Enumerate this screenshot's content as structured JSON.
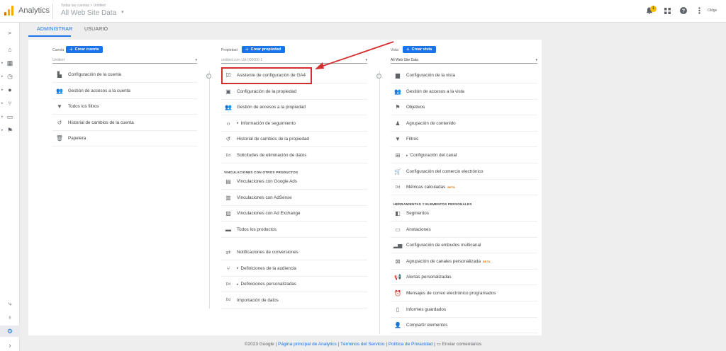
{
  "topbar": {
    "app_title": "Analytics",
    "account_line": "Todas las cuentas > Untitled",
    "view_name": "All Web Site Data",
    "notification_count": "1",
    "user_name": "Oldge",
    "icons": [
      "analytics-logo-icon",
      "bell-icon",
      "apps-icon",
      "help-icon",
      "more-vert-icon"
    ]
  },
  "leftnav": {
    "icons": [
      "search-icon",
      "home-icon",
      "dashboard-icon",
      "clock-icon",
      "person-icon",
      "branch-icon",
      "display-icon",
      "flag-icon",
      "link-icon",
      "lightbulb-icon",
      "gear-icon",
      "chevron-right-icon"
    ]
  },
  "tabs": [
    {
      "label": "ADMINISTRAR",
      "active": true
    },
    {
      "label": "USUARIO",
      "active": false
    }
  ],
  "columns": {
    "cuenta": {
      "label": "Cuenta",
      "create_label": "Crear cuenta",
      "selector": "Untitled",
      "items": [
        {
          "icon": "building-icon",
          "label": "Configuración de la cuenta"
        },
        {
          "icon": "people-icon",
          "label": "Gestión de accesos a la cuenta"
        },
        {
          "icon": "filter-icon",
          "label": "Todos los filtros"
        },
        {
          "icon": "history-icon",
          "label": "Historial de cambios de la cuenta"
        },
        {
          "icon": "trash-icon",
          "label": "Papelera"
        }
      ]
    },
    "propiedad": {
      "label": "Propiedad",
      "create_label": "Crear propiedad",
      "selector": "untitled.com UA-000000-1",
      "items": [
        {
          "icon": "checkbox-icon",
          "label": "Asistente de configuración de GA4"
        },
        {
          "icon": "window-icon",
          "label": "Configuración de la propiedad"
        },
        {
          "icon": "people-icon",
          "label": "Gestión de accesos a la propiedad"
        },
        {
          "icon": "code-icon",
          "label": "Información de seguimiento"
        },
        {
          "icon": "history-icon",
          "label": "Historial de cambios de la propiedad"
        },
        {
          "icon": "dd-icon",
          "label": "Solicitudes de eliminación de datos"
        }
      ],
      "section_title": "VINCULACIONES CON OTROS PRODUCTOS",
      "linked_items": [
        {
          "icon": "ads-icon",
          "label": "Vinculaciones con Google Ads"
        },
        {
          "icon": "adsense-icon",
          "label": "Vinculaciones con AdSense"
        },
        {
          "icon": "adexchange-icon",
          "label": "Vinculaciones con Ad Exchange"
        },
        {
          "icon": "products-icon",
          "label": "Todos los productos"
        }
      ],
      "other_items": [
        {
          "icon": "conversion-icon",
          "label": "Notificaciones de conversiones"
        },
        {
          "icon": "audience-icon",
          "label": "Definiciones de la audiencia"
        },
        {
          "icon": "dd-icon",
          "label": "Definiciones personalizadas"
        },
        {
          "icon": "dd-icon",
          "label": "Importación de datos"
        }
      ]
    },
    "vista": {
      "label": "Vista",
      "create_label": "Crear vista",
      "selector": "All Web Site Data",
      "items": [
        {
          "icon": "document-icon",
          "label": "Configuración de la vista"
        },
        {
          "icon": "people-icon",
          "label": "Gestión de accesos a la vista"
        },
        {
          "icon": "flag-icon",
          "label": "Objetivos"
        },
        {
          "icon": "person-walk-icon",
          "label": "Agrupación de contenido"
        },
        {
          "icon": "filter-icon",
          "label": "Filtros"
        },
        {
          "icon": "channel-icon",
          "label": "Configuración del canal"
        },
        {
          "icon": "cart-icon",
          "label": "Configuración del comercio electrónico"
        },
        {
          "icon": "dd-icon",
          "label": "Métricas calculadas",
          "beta": "BETA"
        }
      ],
      "section_title": "HERRAMIENTAS Y ELEMENTOS PERSONALES",
      "tool_items": [
        {
          "icon": "segments-icon",
          "label": "Segmentos"
        },
        {
          "icon": "annotation-icon",
          "label": "Anotaciones"
        },
        {
          "icon": "bar-chart-icon",
          "label": "Configuración de embudos multicanal"
        },
        {
          "icon": "channel-group-icon",
          "label": "Agrupación de canales personalizada",
          "beta": "BETA"
        },
        {
          "icon": "megaphone-icon",
          "label": "Alertas personalizadas"
        },
        {
          "icon": "alarm-icon",
          "label": "Mensajes de correo electrónico programados"
        },
        {
          "icon": "saved-report-icon",
          "label": "Informes guardados"
        },
        {
          "icon": "share-person-icon",
          "label": "Compartir elementos"
        }
      ]
    }
  },
  "footer": {
    "copyright": "©2023 Google |",
    "link1": "Página principal de Analytics",
    "sep1": "|",
    "link2": "Términos del Servicio",
    "sep2": "|",
    "link3": "Política de Privacidad",
    "sep3": "|",
    "feedback": "Enviar comentarios"
  },
  "colors": {
    "accent": "#1a73e8",
    "highlight": "#d32f2f",
    "logo_orange": "#f9ab00",
    "logo_dark": "#e37400"
  }
}
